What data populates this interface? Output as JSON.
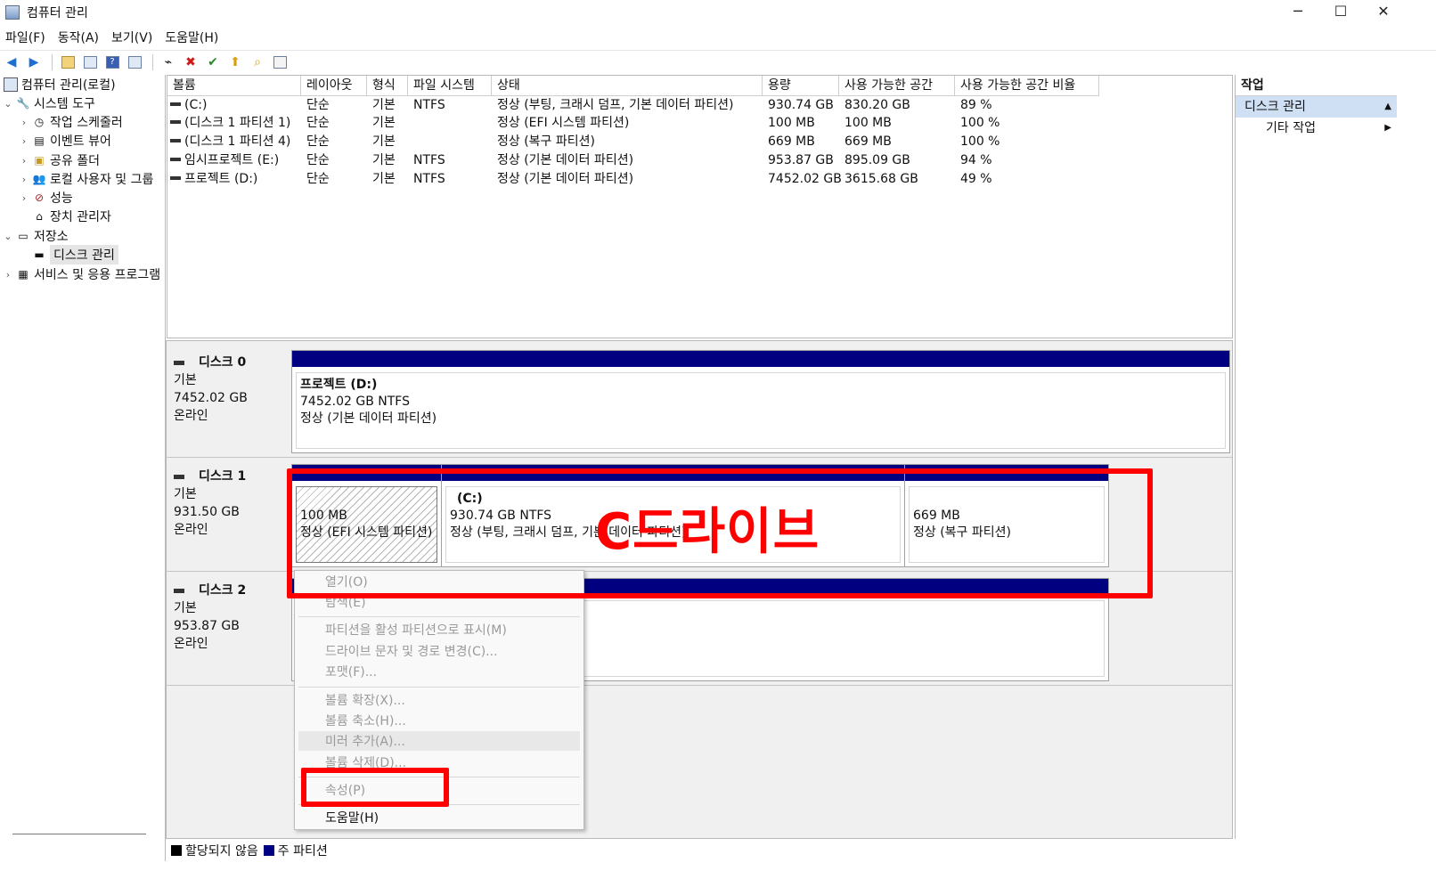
{
  "window": {
    "title": "컴퓨터 관리",
    "minimize": "─",
    "maximize": "☐",
    "close": "✕"
  },
  "menu": [
    "파일(F)",
    "동작(A)",
    "보기(V)",
    "도움말(H)"
  ],
  "tree": {
    "root": "컴퓨터 관리(로컬)",
    "system_tools": "시스템 도구",
    "task_scheduler": "작업 스케줄러",
    "event_viewer": "이벤트 뷰어",
    "shared_folders": "공유 폴더",
    "local_users": "로컬 사용자 및 그룹",
    "performance": "성능",
    "device_manager": "장치 관리자",
    "storage": "저장소",
    "disk_management": "디스크 관리",
    "services": "서비스 및 응용 프로그램"
  },
  "list": {
    "columns": [
      "볼륨",
      "레이아웃",
      "형식",
      "파일 시스템",
      "상태",
      "용량",
      "사용 가능한 공간",
      "사용 가능한 공간 비율"
    ],
    "rows": [
      [
        "(C:)",
        "단순",
        "기본",
        "NTFS",
        "정상 (부팅, 크래시 덤프, 기본 데이터 파티션)",
        "930.74 GB",
        "830.20 GB",
        "89 %"
      ],
      [
        "(디스크 1 파티션 1)",
        "단순",
        "기본",
        "",
        "정상 (EFI 시스템 파티션)",
        "100 MB",
        "100 MB",
        "100 %"
      ],
      [
        "(디스크 1 파티션 4)",
        "단순",
        "기본",
        "",
        "정상 (복구 파티션)",
        "669 MB",
        "669 MB",
        "100 %"
      ],
      [
        "임시프로젝트 (E:)",
        "단순",
        "기본",
        "NTFS",
        "정상 (기본 데이터 파티션)",
        "953.87 GB",
        "895.09 GB",
        "94 %"
      ],
      [
        "프로젝트 (D:)",
        "단순",
        "기본",
        "NTFS",
        "정상 (기본 데이터 파티션)",
        "7452.02 GB",
        "3615.68 GB",
        "49 %"
      ]
    ]
  },
  "disks": {
    "d0": {
      "name": "디스크 0",
      "type": "기본",
      "size": "7452.02 GB",
      "status": "온라인",
      "p1": {
        "name": "프로젝트  (D:)",
        "size": "7452.02 GB NTFS",
        "status": "정상 (기본 데이터 파티션)"
      }
    },
    "d1": {
      "name": "디스크 1",
      "type": "기본",
      "size": "931.50 GB",
      "status": "온라인",
      "p1": {
        "size": "100 MB",
        "status": "정상 (EFI 시스템 파티션)"
      },
      "p2": {
        "name": "(C:)",
        "size": "930.74 GB NTFS",
        "status": "정상 (부팅, 크래시 덤프, 기본 데이터 파티션)"
      },
      "p3": {
        "size": "669 MB",
        "status": "정상 (복구 파티션)"
      }
    },
    "d2": {
      "name": "디스크 2",
      "type": "기본",
      "size": "953.87 GB",
      "status": "온라인"
    }
  },
  "legend": {
    "unallocated": "할당되지 않음",
    "primary": "주 파티션"
  },
  "actions": {
    "title": "작업",
    "section": "디스크 관리",
    "more": "기타 작업"
  },
  "context_menu": {
    "open": "열기(O)",
    "explore": "탐색(E)",
    "mark_active": "파티션을 활성 파티션으로 표시(M)",
    "change_letter": "드라이브 문자 및 경로 변경(C)...",
    "format": "포맷(F)...",
    "extend": "볼륨 확장(X)...",
    "shrink": "볼륨 축소(H)...",
    "add_mirror": "미러 추가(A)...",
    "delete": "볼륨 삭제(D)...",
    "properties": "속성(P)",
    "help": "도움말(H)"
  },
  "annotation": {
    "text": "C드라이브",
    "color": "#ff0000"
  },
  "colors": {
    "primary_partition": "#000080",
    "selection": "#cfe0f4",
    "annotation": "#ff0000"
  }
}
